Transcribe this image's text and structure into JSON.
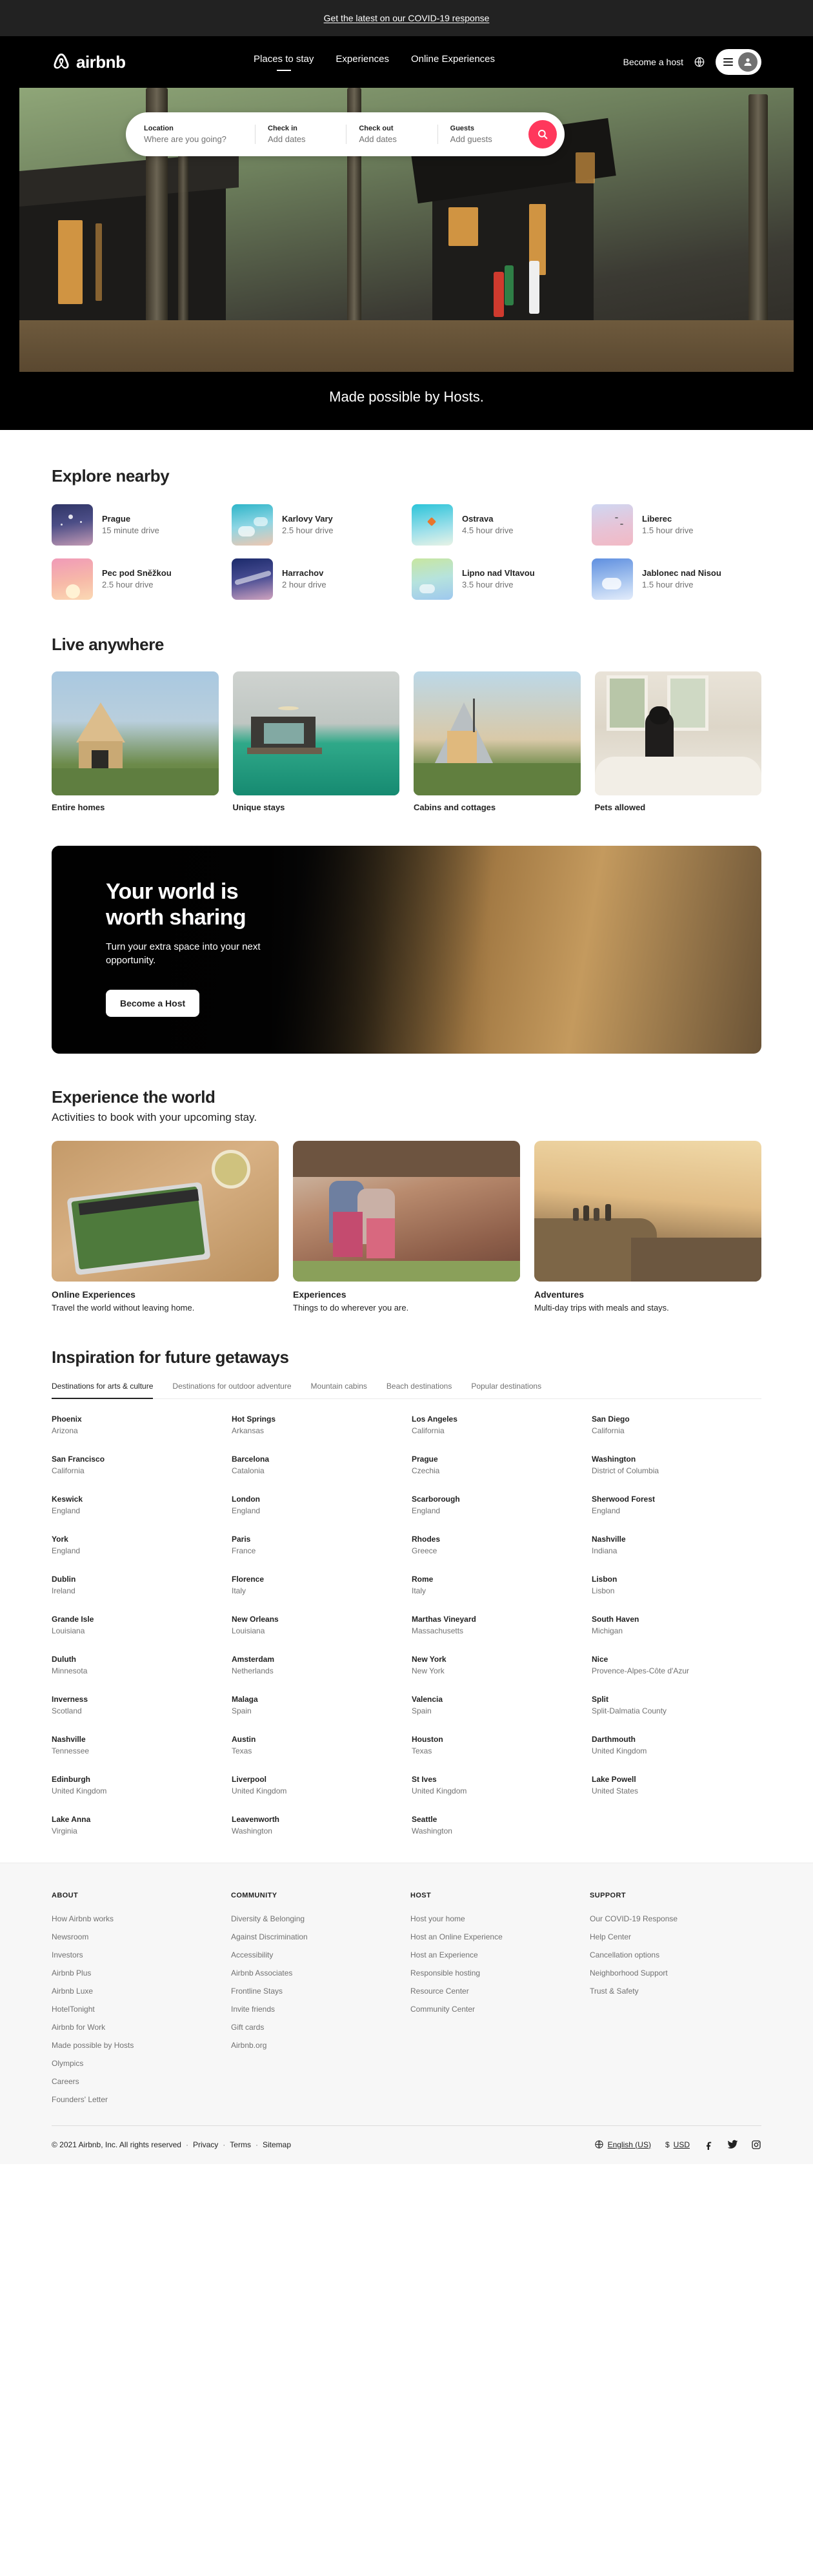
{
  "covid_banner": {
    "text": "Get the latest on our COVID-19 response"
  },
  "nav": {
    "logo_text": "airbnb",
    "links": [
      {
        "label": "Places to stay",
        "active": true
      },
      {
        "label": "Experiences",
        "active": false
      },
      {
        "label": "Online Experiences",
        "active": false
      }
    ],
    "become_host": "Become a host"
  },
  "search": {
    "fields": [
      {
        "label": "Location",
        "value": "Where are you going?"
      },
      {
        "label": "Check in",
        "value": "Add dates"
      },
      {
        "label": "Check out",
        "value": "Add dates"
      },
      {
        "label": "Guests",
        "value": "Add guests"
      }
    ]
  },
  "hero": {
    "caption": "Made possible by Hosts."
  },
  "explore": {
    "title": "Explore nearby",
    "items": [
      {
        "name": "Prague",
        "meta": "15 minute drive"
      },
      {
        "name": "Karlovy Vary",
        "meta": "2.5 hour drive"
      },
      {
        "name": "Ostrava",
        "meta": "4.5 hour drive"
      },
      {
        "name": "Liberec",
        "meta": "1.5 hour drive"
      },
      {
        "name": "Pec pod Sněžkou",
        "meta": "2.5 hour drive"
      },
      {
        "name": "Harrachov",
        "meta": "2 hour drive"
      },
      {
        "name": "Lipno nad Vltavou",
        "meta": "3.5 hour drive"
      },
      {
        "name": "Jablonec nad Nisou",
        "meta": "1.5 hour drive"
      }
    ]
  },
  "live": {
    "title": "Live anywhere",
    "items": [
      {
        "label": "Entire homes"
      },
      {
        "label": "Unique stays"
      },
      {
        "label": "Cabins and cottages"
      },
      {
        "label": "Pets allowed"
      }
    ]
  },
  "host_banner": {
    "title_line1": "Your world is",
    "title_line2": "worth sharing",
    "subtitle": "Turn your extra space into your next opportunity.",
    "button": "Become a Host"
  },
  "experience": {
    "title": "Experience the world",
    "subtitle": "Activities to book with your upcoming stay.",
    "items": [
      {
        "name": "Online Experiences",
        "desc": "Travel the world without leaving home."
      },
      {
        "name": "Experiences",
        "desc": "Things to do wherever you are."
      },
      {
        "name": "Adventures",
        "desc": "Multi-day trips with meals and stays."
      }
    ]
  },
  "inspiration": {
    "title": "Inspiration for future getaways",
    "tabs": [
      {
        "label": "Destinations for arts & culture",
        "active": true
      },
      {
        "label": "Destinations for outdoor adventure",
        "active": false
      },
      {
        "label": "Mountain cabins",
        "active": false
      },
      {
        "label": "Beach destinations",
        "active": false
      },
      {
        "label": "Popular destinations",
        "active": false
      }
    ],
    "destinations": [
      {
        "city": "Phoenix",
        "region": "Arizona"
      },
      {
        "city": "Hot Springs",
        "region": "Arkansas"
      },
      {
        "city": "Los Angeles",
        "region": "California"
      },
      {
        "city": "San Diego",
        "region": "California"
      },
      {
        "city": "San Francisco",
        "region": "California"
      },
      {
        "city": "Barcelona",
        "region": "Catalonia"
      },
      {
        "city": "Prague",
        "region": "Czechia"
      },
      {
        "city": "Washington",
        "region": "District of Columbia"
      },
      {
        "city": "Keswick",
        "region": "England"
      },
      {
        "city": "London",
        "region": "England"
      },
      {
        "city": "Scarborough",
        "region": "England"
      },
      {
        "city": "Sherwood Forest",
        "region": "England"
      },
      {
        "city": "York",
        "region": "England"
      },
      {
        "city": "Paris",
        "region": "France"
      },
      {
        "city": "Rhodes",
        "region": "Greece"
      },
      {
        "city": "Nashville",
        "region": "Indiana"
      },
      {
        "city": "Dublin",
        "region": "Ireland"
      },
      {
        "city": "Florence",
        "region": "Italy"
      },
      {
        "city": "Rome",
        "region": "Italy"
      },
      {
        "city": "Lisbon",
        "region": "Lisbon"
      },
      {
        "city": "Grande Isle",
        "region": "Louisiana"
      },
      {
        "city": "New Orleans",
        "region": "Louisiana"
      },
      {
        "city": "Marthas Vineyard",
        "region": "Massachusetts"
      },
      {
        "city": "South Haven",
        "region": "Michigan"
      },
      {
        "city": "Duluth",
        "region": "Minnesota"
      },
      {
        "city": "Amsterdam",
        "region": "Netherlands"
      },
      {
        "city": "New York",
        "region": "New York"
      },
      {
        "city": "Nice",
        "region": "Provence-Alpes-Côte d'Azur"
      },
      {
        "city": "Inverness",
        "region": "Scotland"
      },
      {
        "city": "Malaga",
        "region": "Spain"
      },
      {
        "city": "Valencia",
        "region": "Spain"
      },
      {
        "city": "Split",
        "region": "Split-Dalmatia County"
      },
      {
        "city": "Nashville",
        "region": "Tennessee"
      },
      {
        "city": "Austin",
        "region": "Texas"
      },
      {
        "city": "Houston",
        "region": "Texas"
      },
      {
        "city": "Darthmouth",
        "region": "United Kingdom"
      },
      {
        "city": "Edinburgh",
        "region": "United Kingdom"
      },
      {
        "city": "Liverpool",
        "region": "United Kingdom"
      },
      {
        "city": "St Ives",
        "region": "United Kingdom"
      },
      {
        "city": "Lake Powell",
        "region": "United States"
      },
      {
        "city": "Lake Anna",
        "region": "Virginia"
      },
      {
        "city": "Leavenworth",
        "region": "Washington"
      },
      {
        "city": "Seattle",
        "region": "Washington"
      }
    ]
  },
  "footer": {
    "columns": [
      {
        "heading": "ABOUT",
        "links": [
          "How Airbnb works",
          "Newsroom",
          "Investors",
          "Airbnb Plus",
          "Airbnb Luxe",
          "HotelTonight",
          "Airbnb for Work",
          "Made possible by Hosts",
          "Olympics",
          "Careers",
          "Founders' Letter"
        ]
      },
      {
        "heading": "COMMUNITY",
        "links": [
          "Diversity & Belonging",
          "Against Discrimination",
          "Accessibility",
          "Airbnb Associates",
          "Frontline Stays",
          "Invite friends",
          "Gift cards",
          "Airbnb.org"
        ]
      },
      {
        "heading": "HOST",
        "links": [
          "Host your home",
          "Host an Online Experience",
          "Host an Experience",
          "Responsible hosting",
          "Resource Center",
          "Community Center"
        ]
      },
      {
        "heading": "SUPPORT",
        "links": [
          "Our COVID-19 Response",
          "Help Center",
          "Cancellation options",
          "Neighborhood Support",
          "Trust & Safety"
        ]
      }
    ],
    "copyright": "© 2021 Airbnb, Inc. All rights reserved",
    "legal_links": [
      "Privacy",
      "Terms",
      "Sitemap"
    ],
    "language": "English (US)",
    "currency": "USD",
    "currency_symbol": "$"
  },
  "colors": {
    "brand": "#ff385c",
    "dark": "#222222",
    "muted": "#717171",
    "footer_bg": "#f7f7f7"
  }
}
